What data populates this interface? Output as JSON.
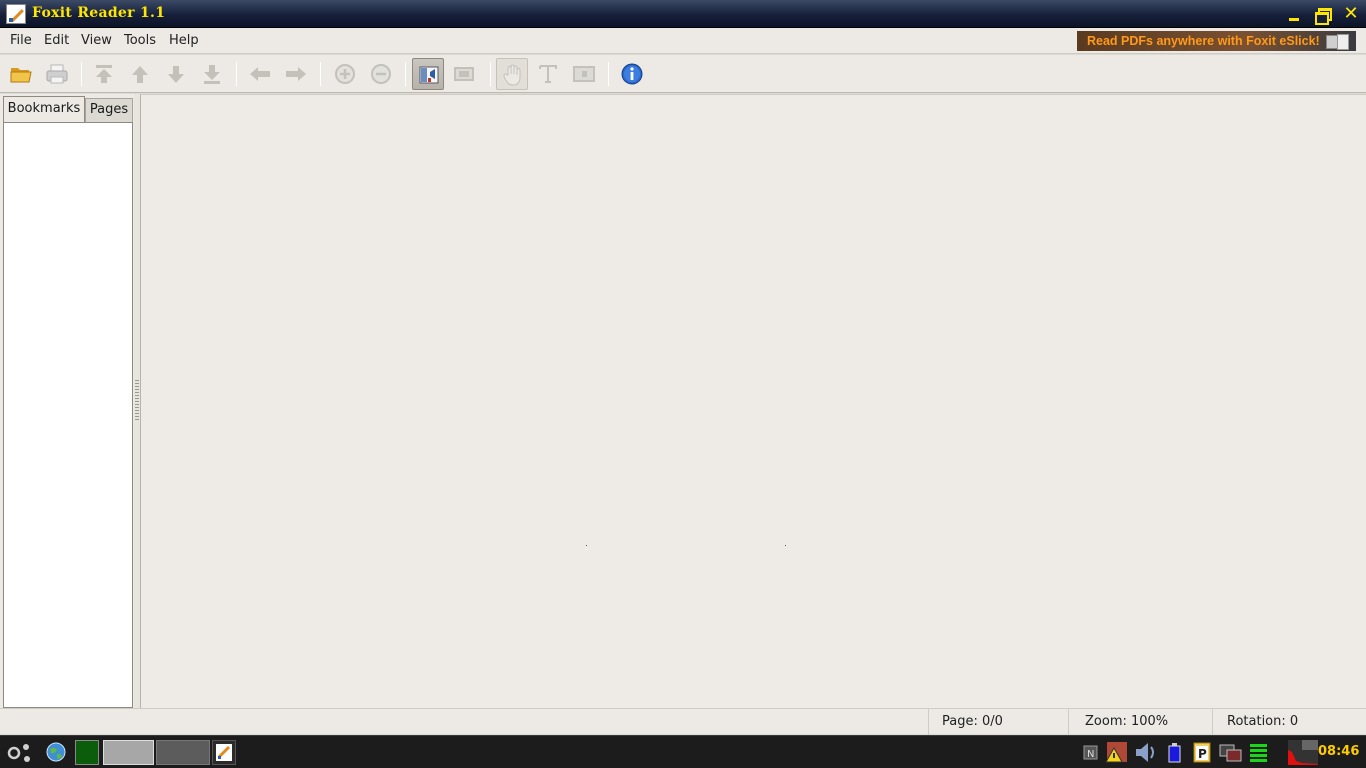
{
  "window": {
    "title": "Foxit Reader 1.1"
  },
  "menu": {
    "items": [
      {
        "label": "File"
      },
      {
        "label": "Edit"
      },
      {
        "label": "View"
      },
      {
        "label": "Tools"
      },
      {
        "label": "Help"
      }
    ],
    "ad_text": "Read PDFs anywhere with Foxit eSlick!"
  },
  "toolbar": {
    "buttons": [
      "open-icon",
      "print-icon",
      "first-page-icon",
      "previous-page-icon",
      "next-page-icon",
      "last-page-icon",
      "go-back-icon",
      "go-forward-icon",
      "zoom-in-icon",
      "zoom-out-icon",
      "bookmarks-panel-icon",
      "full-screen-icon",
      "hand-tool-icon",
      "select-text-icon",
      "snapshot-icon",
      "about-info-icon"
    ],
    "active": "bookmarks-panel-icon"
  },
  "side_panel": {
    "tabs": [
      {
        "label": "Bookmarks",
        "selected": true
      },
      {
        "label": "Pages",
        "selected": false
      }
    ]
  },
  "status": {
    "page": "Page: 0/0",
    "zoom": "Zoom: 100%",
    "rotation": "Rotation: 0"
  },
  "taskbar": {
    "clock": "08:46",
    "colors": {
      "accent": "#ffcc00",
      "title_text": "#ffe600",
      "ad_text": "#ff9a1a"
    }
  }
}
